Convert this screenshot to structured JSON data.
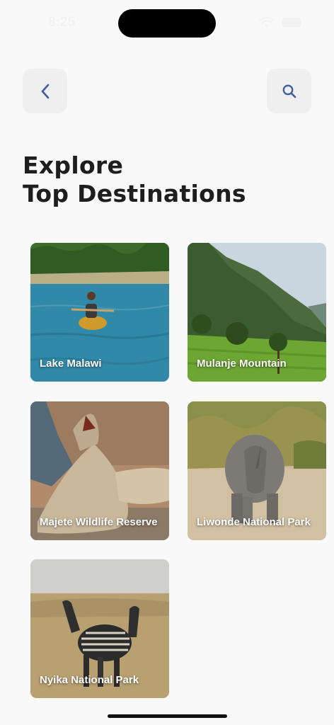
{
  "status_bar": {
    "time": "8:25",
    "icons": [
      "wifi-icon",
      "battery-icon"
    ]
  },
  "header": {
    "back_icon": "chevron-left-icon",
    "search_icon": "search-icon",
    "icon_color": "#3f5d9c"
  },
  "title": {
    "line1": "Explore",
    "line2": "Top Destinations"
  },
  "destinations": [
    {
      "label": "Lake Malawi",
      "image": "lake-canoe-photo"
    },
    {
      "label": "Mulanje Mountain",
      "image": "mountain-tea-photo"
    },
    {
      "label": "Majete Wildlife Reserve",
      "image": "lions-photo"
    },
    {
      "label": "Liwonde National Park",
      "image": "rhino-photo"
    },
    {
      "label": "Nyika National Park",
      "image": "zebras-photo"
    }
  ]
}
